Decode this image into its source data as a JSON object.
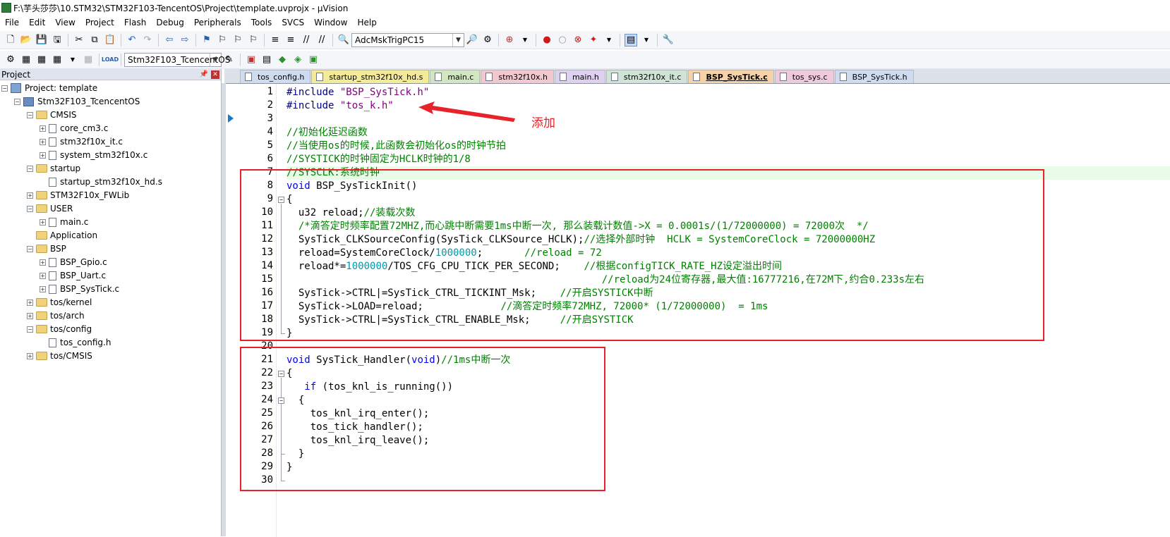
{
  "window": {
    "title": "F:\\芋头莎莎\\10.STM32\\STM32F103-TencentOS\\Project\\template.uvprojx - µVision"
  },
  "menu": [
    "File",
    "Edit",
    "View",
    "Project",
    "Flash",
    "Debug",
    "Peripherals",
    "Tools",
    "SVCS",
    "Window",
    "Help"
  ],
  "toolbar": {
    "find_combo": "AdcMskTrigPC15",
    "target_combo": "Stm32F103_TcencentOS",
    "load_label": "LOAD"
  },
  "project": {
    "title": "Project",
    "root": "Project: template",
    "target": "Stm32F103_TcencentOS",
    "groups": [
      {
        "name": "CMSIS",
        "files": [
          "core_cm3.c",
          "stm32f10x_it.c",
          "system_stm32f10x.c"
        ]
      },
      {
        "name": "startup",
        "files": [
          "startup_stm32f10x_hd.s"
        ]
      },
      {
        "name": "STM32F10x_FWLib",
        "files": []
      },
      {
        "name": "USER",
        "files": [
          "main.c"
        ]
      },
      {
        "name": "Application",
        "files": []
      },
      {
        "name": "BSP",
        "files": [
          "BSP_Gpio.c",
          "BSP_Uart.c",
          "BSP_SysTick.c"
        ]
      },
      {
        "name": "tos/kernel",
        "files": []
      },
      {
        "name": "tos/arch",
        "files": []
      },
      {
        "name": "tos/config",
        "files": [
          "tos_config.h"
        ]
      },
      {
        "name": "tos/CMSIS",
        "files": []
      }
    ]
  },
  "tabs": [
    {
      "label": "tos_config.h",
      "color": "#cfdcf0"
    },
    {
      "label": "startup_stm32f10x_hd.s",
      "color": "#f3ea9a"
    },
    {
      "label": "main.c",
      "color": "#d2e6c2"
    },
    {
      "label": "stm32f10x.h",
      "color": "#f1c8cf"
    },
    {
      "label": "main.h",
      "color": "#ded0ef"
    },
    {
      "label": "stm32f10x_it.c",
      "color": "#cfe3d6"
    },
    {
      "label": "BSP_SysTick.c",
      "color": "#f6d2a8",
      "active": true
    },
    {
      "label": "tos_sys.c",
      "color": "#efcadc"
    },
    {
      "label": "BSP_SysTick.h",
      "color": "#cfdcf0"
    }
  ],
  "code": [
    {
      "n": "1",
      "t": [
        [
          "pp",
          "#include "
        ],
        [
          "st",
          "\"BSP_SysTick.h\""
        ]
      ]
    },
    {
      "n": "2",
      "t": [
        [
          "pp",
          "#include "
        ],
        [
          "st",
          "\"tos_k.h\""
        ]
      ]
    },
    {
      "n": "3",
      "t": []
    },
    {
      "n": "4",
      "t": [
        [
          "cm",
          "//初始化延迟函数"
        ]
      ]
    },
    {
      "n": "5",
      "t": [
        [
          "cm",
          "//当使用os的时候,此函数会初始化os的时钟节拍"
        ]
      ]
    },
    {
      "n": "6",
      "t": [
        [
          "cm",
          "//SYSTICK的时钟固定为HCLK时钟的1/8"
        ]
      ]
    },
    {
      "n": "7",
      "t": [
        [
          "cm",
          "//SYSCLK:系统时钟"
        ]
      ]
    },
    {
      "n": "8",
      "t": [
        [
          "kw",
          "void"
        ],
        [
          "",
          " BSP_SysTickInit()"
        ]
      ]
    },
    {
      "n": "9",
      "t": [
        [
          "",
          "{"
        ]
      ]
    },
    {
      "n": "10",
      "t": [
        [
          "",
          "  u32 reload;"
        ],
        [
          "cm",
          "//装载次数"
        ]
      ]
    },
    {
      "n": "11",
      "t": [
        [
          "",
          "  "
        ],
        [
          "cm",
          "/*滴答定时频率配置72MHZ,而心跳中断需要1ms中断一次, 那么装载计数值->X = 0.0001s/(1/72000000) = 72000次  */"
        ]
      ]
    },
    {
      "n": "12",
      "t": [
        [
          "",
          "  SysTick_CLKSourceConfig(SysTick_CLKSource_HCLK);"
        ],
        [
          "cm",
          "//选择外部时钟  HCLK = SystemCoreClock = 72000000HZ"
        ]
      ]
    },
    {
      "n": "13",
      "t": [
        [
          "",
          "  reload=SystemCoreClock/"
        ],
        [
          "nm",
          "1000000"
        ],
        [
          "",
          ";       "
        ],
        [
          "cm",
          "//reload = 72"
        ]
      ]
    },
    {
      "n": "14",
      "t": [
        [
          "",
          "  reload*="
        ],
        [
          "nm",
          "1000000"
        ],
        [
          "",
          "/TOS_CFG_CPU_TICK_PER_SECOND;    "
        ],
        [
          "cm",
          "//根据configTICK_RATE_HZ设定溢出时间"
        ]
      ]
    },
    {
      "n": "15",
      "t": [
        [
          "",
          "                                                     "
        ],
        [
          "cm",
          "//reload为24位寄存器,最大值:16777216,在72M下,约合0.233s左右"
        ]
      ]
    },
    {
      "n": "16",
      "t": [
        [
          "",
          "  SysTick->CTRL|=SysTick_CTRL_TICKINT_Msk;    "
        ],
        [
          "cm",
          "//开启SYSTICK中断"
        ]
      ]
    },
    {
      "n": "17",
      "t": [
        [
          "",
          "  SysTick->LOAD=reload;             "
        ],
        [
          "cm",
          "//滴答定时频率72MHZ, 72000* (1/72000000)  = 1ms"
        ]
      ]
    },
    {
      "n": "18",
      "t": [
        [
          "",
          "  SysTick->CTRL|=SysTick_CTRL_ENABLE_Msk;     "
        ],
        [
          "cm",
          "//开启SYSTICK"
        ]
      ]
    },
    {
      "n": "19",
      "t": [
        [
          "",
          "}"
        ]
      ]
    },
    {
      "n": "20",
      "t": []
    },
    {
      "n": "21",
      "t": [
        [
          "kw",
          "void"
        ],
        [
          "",
          " SysTick_Handler("
        ],
        [
          "kw",
          "void"
        ],
        [
          "",
          ")"
        ],
        [
          "cm",
          "//1ms中断一次"
        ]
      ]
    },
    {
      "n": "22",
      "t": [
        [
          "",
          "{"
        ]
      ]
    },
    {
      "n": "23",
      "t": [
        [
          "",
          "   "
        ],
        [
          "kw",
          "if"
        ],
        [
          "",
          " (tos_knl_is_running())"
        ]
      ]
    },
    {
      "n": "24",
      "t": [
        [
          "",
          "  {"
        ]
      ]
    },
    {
      "n": "25",
      "t": [
        [
          "",
          "    tos_knl_irq_enter();"
        ]
      ]
    },
    {
      "n": "26",
      "t": [
        [
          "",
          "    tos_tick_handler();"
        ]
      ]
    },
    {
      "n": "27",
      "t": [
        [
          "",
          "    tos_knl_irq_leave();"
        ]
      ]
    },
    {
      "n": "28",
      "t": [
        [
          "",
          "  }"
        ]
      ]
    },
    {
      "n": "29",
      "t": [
        [
          "",
          "}"
        ]
      ]
    },
    {
      "n": "30",
      "t": []
    }
  ],
  "annotation": {
    "text": "添加",
    "color": "#e8222b"
  }
}
